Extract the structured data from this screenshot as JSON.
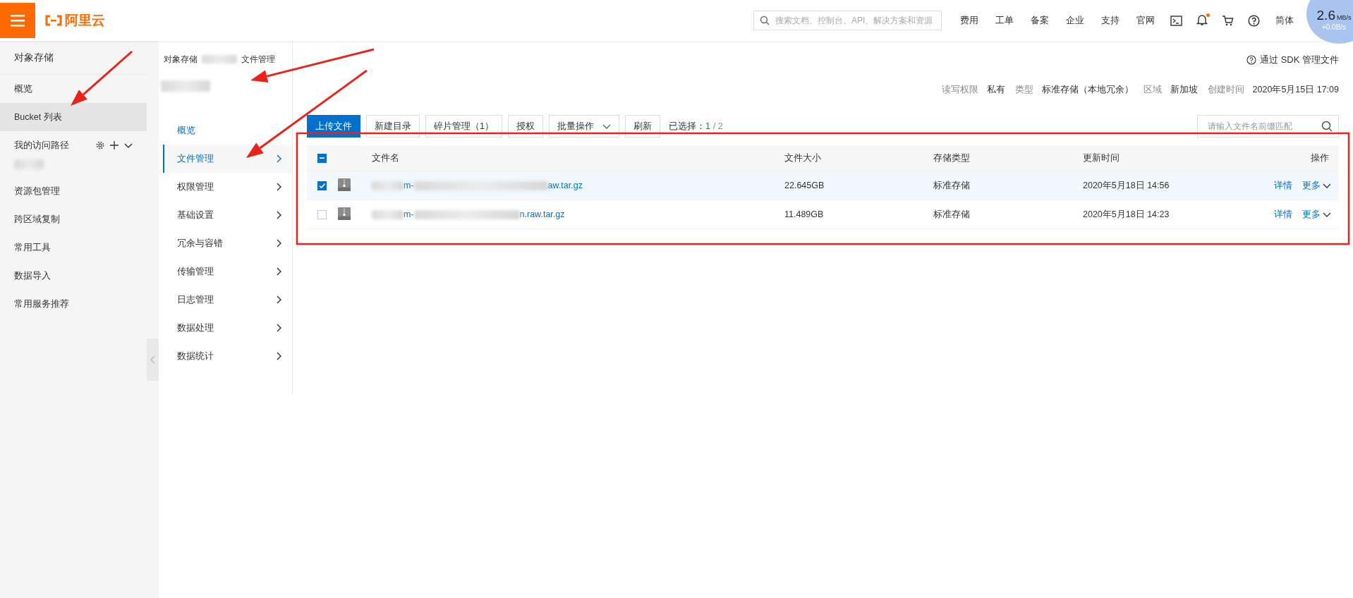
{
  "header": {
    "logo": "阿里云",
    "search_placeholder": "搜索文档、控制台、API、解决方案和资源",
    "links": [
      "费用",
      "工单",
      "备案",
      "企业",
      "支持",
      "官网"
    ],
    "notification_dot": true,
    "language": "简体"
  },
  "speed_widget": {
    "download": "2.6",
    "unit": "MB/s",
    "upload": "+0.0B/s"
  },
  "sidebar": {
    "title": "对象存储",
    "items": [
      {
        "kind": "link",
        "label": "概览",
        "selected": false
      },
      {
        "kind": "link",
        "label": "Bucket 列表",
        "selected": true
      },
      {
        "kind": "group",
        "label": "我的访问路径",
        "selected": false
      },
      {
        "kind": "redacted",
        "selected": false
      },
      {
        "kind": "link",
        "label": "资源包管理",
        "selected": false
      },
      {
        "kind": "link",
        "label": "跨区域复制",
        "selected": false
      },
      {
        "kind": "link",
        "label": "常用工具",
        "selected": false
      },
      {
        "kind": "link",
        "label": "数据导入",
        "selected": false
      },
      {
        "kind": "link",
        "label": "常用服务推荐",
        "selected": false
      }
    ]
  },
  "bucket_nav": {
    "breadcrumb": [
      "对象存储",
      "文件管理"
    ],
    "items": [
      {
        "kind": "plain",
        "label": "概览",
        "selected": false
      },
      {
        "kind": "submenu",
        "label": "文件管理",
        "selected": true
      },
      {
        "kind": "submenu",
        "label": "权限管理",
        "selected": false
      },
      {
        "kind": "submenu",
        "label": "基础设置",
        "selected": false
      },
      {
        "kind": "submenu",
        "label": "冗余与容错",
        "selected": false
      },
      {
        "kind": "submenu",
        "label": "传输管理",
        "selected": false
      },
      {
        "kind": "submenu",
        "label": "日志管理",
        "selected": false
      },
      {
        "kind": "submenu",
        "label": "数据处理",
        "selected": false
      },
      {
        "kind": "submenu",
        "label": "数据统计",
        "selected": false
      }
    ]
  },
  "bucket_info": {
    "sdk_link": "通过 SDK 管理文件",
    "fields": [
      {
        "label": "读写权限",
        "value": "私有"
      },
      {
        "label": "类型",
        "value": "标准存储（本地冗余）"
      },
      {
        "label": "区域",
        "value": "新加坡"
      },
      {
        "label": "创建时间",
        "value": "2020年5月15日 17:09"
      }
    ]
  },
  "toolbar": {
    "buttons": [
      {
        "kind": "primary",
        "label": "上传文件"
      },
      {
        "kind": "default",
        "label": "新建目录"
      },
      {
        "kind": "default",
        "label": "碎片管理（1）"
      },
      {
        "kind": "default",
        "label": "授权"
      },
      {
        "kind": "dropdown",
        "label": "批量操作"
      },
      {
        "kind": "default",
        "label": "刷新"
      }
    ],
    "selection_label": "已选择：",
    "selected_count": "1",
    "total": "/ 2",
    "search_placeholder": "请输入文件名前缀匹配"
  },
  "table": {
    "header_checkbox_indeterminate": true,
    "columns": [
      "文件名",
      "文件大小",
      "存储类型",
      "更新时间",
      "操作"
    ],
    "rows": [
      {
        "checked": true,
        "name_start": "m-",
        "name_end": "aw.tar.gz",
        "size": "22.645GB",
        "storage": "标准存储",
        "updated": "2020年5月18日 14:56",
        "actions": [
          "详情",
          "更多"
        ]
      },
      {
        "checked": false,
        "name_start": "m-",
        "name_end": "n.raw.tar.gz",
        "size": "11.489GB",
        "storage": "标准存储",
        "updated": "2020年5月18日 14:23",
        "actions": [
          "详情",
          "更多"
        ]
      }
    ]
  }
}
